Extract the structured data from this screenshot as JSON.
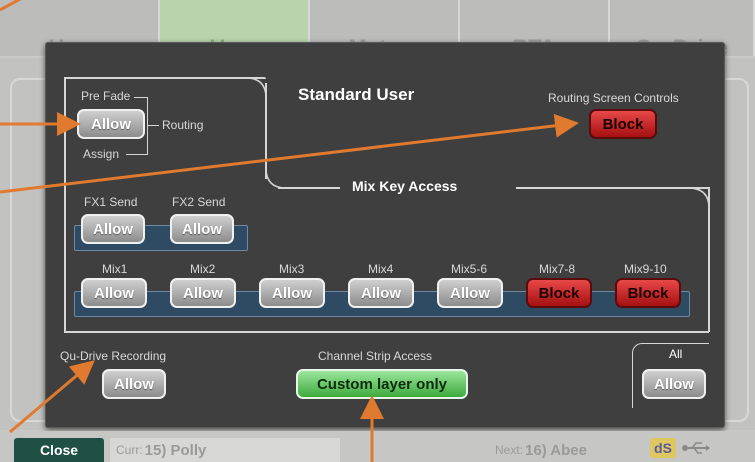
{
  "tabs": [
    {
      "label": "Home"
    },
    {
      "label": "User",
      "active": true
    },
    {
      "label": "Meters"
    },
    {
      "label": "RTA"
    },
    {
      "label": "Qu-Drive"
    }
  ],
  "dialog": {
    "title": "Standard User",
    "pre_fade": {
      "label_top": "Pre Fade",
      "label_bottom": "Assign",
      "label_side": "Routing",
      "button": "Allow"
    },
    "routing_screen_controls": {
      "label": "Routing Screen Controls",
      "button": "Block"
    },
    "mix_key_access": {
      "label": "Mix Key Access",
      "fx_sends": [
        {
          "label": "FX1 Send",
          "button": "Allow"
        },
        {
          "label": "FX2 Send",
          "button": "Allow"
        }
      ],
      "mixes": [
        {
          "label": "Mix1",
          "button": "Allow"
        },
        {
          "label": "Mix2",
          "button": "Allow"
        },
        {
          "label": "Mix3",
          "button": "Allow"
        },
        {
          "label": "Mix4",
          "button": "Allow"
        },
        {
          "label": "Mix5-6",
          "button": "Allow"
        },
        {
          "label": "Mix7-8",
          "button": "Block"
        },
        {
          "label": "Mix9-10",
          "button": "Block"
        }
      ]
    },
    "qu_drive_recording": {
      "label": "Qu-Drive Recording",
      "button": "Allow"
    },
    "channel_strip_access": {
      "label": "Channel Strip Access",
      "button": "Custom layer only"
    },
    "all": {
      "label": "All",
      "button": "Allow"
    }
  },
  "status": {
    "close_label": "Close",
    "curr_prefix": "Curr:",
    "curr_scene": "15) Polly",
    "next_prefix": "Next:",
    "next_scene": "16) Abee",
    "ds_label": "dS",
    "usb_icon": "usb-icon"
  },
  "colors": {
    "allow": "#a9a9a9",
    "block": "#c41c1c",
    "custom": "#5cc85c",
    "callout_arrow": "#e07a2e",
    "mix_bar": "#2f4a63"
  }
}
